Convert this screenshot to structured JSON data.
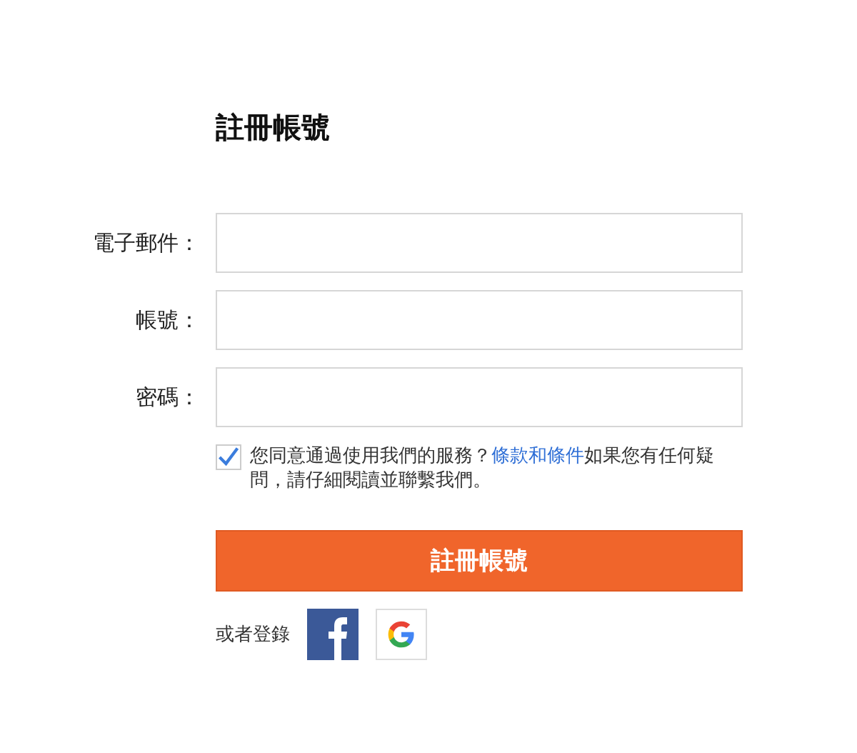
{
  "title": "註冊帳號",
  "fields": [
    {
      "label": "電子郵件："
    },
    {
      "label": "帳號："
    },
    {
      "label": "密碼："
    }
  ],
  "agreement": {
    "checked": true,
    "before": "您同意通過使用我們的服務？",
    "link": "條款和條件",
    "after": "如果您有任何疑問，請仔細閱讀並聯繫我們。"
  },
  "submit": "註冊帳號",
  "social": {
    "label": "或者登錄",
    "providers": [
      {
        "kind": "facebook"
      },
      {
        "kind": "google"
      }
    ]
  }
}
